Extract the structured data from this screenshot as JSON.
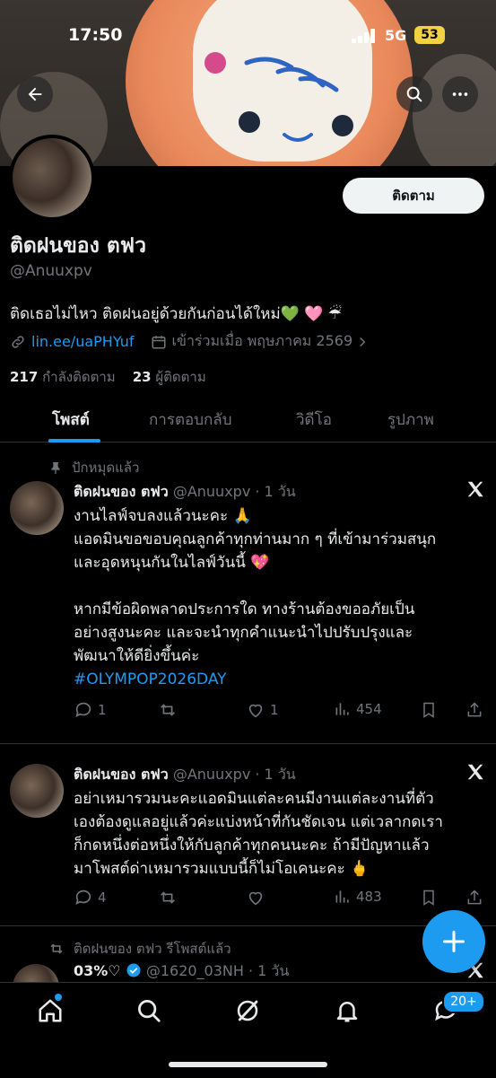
{
  "status_bar": {
    "time": "17:50",
    "network": "5G",
    "battery": "53"
  },
  "header": {
    "back_icon": "arrow-left-icon",
    "search_icon": "search-icon",
    "more_icon": "more-icon"
  },
  "profile": {
    "follow_label": "ติดตาม",
    "name": "ติดฝนของ ตฟว",
    "handle": "@Anuuxpv",
    "bio": "ติดเธอไม่ไหว ติดฝนอยู่ด้วยกันก่อนได้ใหม่💚 🩷 ☔",
    "link": "lin.ee/uaPHYuf",
    "joined": "เข้าร่วมเมื่อ พฤษภาคม 2569",
    "following_count": "217",
    "following_label": "กำลังติดตาม",
    "followers_count": "23",
    "followers_label": "ผู้ติดตาม"
  },
  "tabs": [
    "โพสต์",
    "การตอบกลับ",
    "วิดีโอ",
    "รูปภาพ"
  ],
  "pinned_label": "ปักหมุดแล้ว",
  "posts": [
    {
      "name": "ติดฝนของ ตฟว",
      "meta": "@Anuuxpv · 1 วัน",
      "lines": [
        "งานไลฟ์จบลงแล้วนะคะ 🙏",
        "แอดมินขอขอบคุณลูกค้าทุกท่านมาก ๆ ที่เข้ามาร่วมสนุก",
        "และอุดหนุนกันในไลฟ์วันนี้ 💖",
        "",
        "หากมีข้อผิดพลาดประการใด ทางร้านต้องขออภัยเป็น",
        "อย่างสูงนะคะ และจะนำทุกคำแนะนำไปปรับปรุงและ",
        "พัฒนาให้ดียิ่งขึ้นค่ะ"
      ],
      "hashtag": "#OLYMPOP2026DAY",
      "replies": "1",
      "reposts": "",
      "likes": "1",
      "views": "454"
    },
    {
      "name": "ติดฝนของ ตฟว",
      "meta": "@Anuuxpv · 1 วัน",
      "lines": [
        "อย่าเหมารวมนะคะแอดมินแต่ละคนมีงานแต่ละงานที่ตัว",
        "เองต้องดูแลอยู่แล้วค่ะแบ่งหน้าที่กันชัดเจน แต่เวลากดเรา",
        "ก็กดหนึ่งต่อหนึ่งให้กับลูกค้าทุกคนนะคะ ถ้ามีปัญหาแล้ว",
        "มาโพสต์ด่าเหมารวมแบบนี้ก็ไม่โอเคนะคะ 🖕"
      ],
      "replies": "4",
      "reposts": "",
      "likes": "",
      "views": "483"
    }
  ],
  "repost": {
    "label": "ติดฝนของ ตฟว รีโพสต์แล้ว",
    "name": "03%♡",
    "meta": "@1620_03NH · 1 วัน"
  },
  "nav": {
    "notification_badge": "20+"
  },
  "colors": {
    "accent": "#1d9bf0",
    "background": "#000000",
    "muted": "#71767b"
  }
}
